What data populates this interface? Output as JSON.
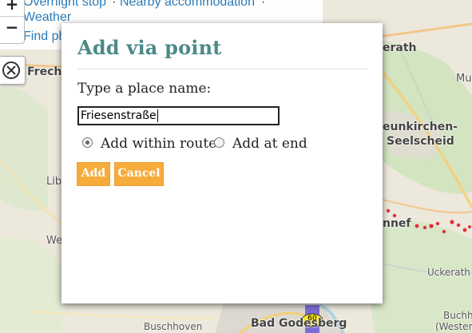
{
  "map": {
    "labels": [
      {
        "text": "Frech",
        "cls": "bold"
      },
      {
        "text": "erath",
        "cls": "bold"
      },
      {
        "text": "Mu",
        "cls": ""
      },
      {
        "text": "eunkirchen-",
        "cls": "bold"
      },
      {
        "text": "Seelscheid",
        "cls": "bold"
      },
      {
        "text": "Lib",
        "cls": ""
      },
      {
        "text": "nnef",
        "cls": "bold"
      },
      {
        "text": "We",
        "cls": ""
      },
      {
        "text": "Uckerath",
        "cls": "small"
      },
      {
        "text": "Buschhoven",
        "cls": "small"
      },
      {
        "text": "Bad Godesberg",
        "cls": "bold"
      },
      {
        "text": "Buchh",
        "cls": "small"
      },
      {
        "text": "(Wester",
        "cls": "small"
      }
    ],
    "route_badge": "60"
  },
  "info": {
    "link_overnight": "Overnight stop",
    "sep1": "·",
    "link_accommodation": "Nearby accommodation",
    "sep2": "·",
    "link_weather": "Weather",
    "link_find": "Find ph"
  },
  "zoom": {
    "in": "+",
    "out": "−"
  },
  "dialog": {
    "title": "Add via point",
    "prompt": "Type a place name:",
    "input_value": "Friesenstraße",
    "options": [
      {
        "label": "Add within route",
        "checked": true
      },
      {
        "label": "Add at end",
        "checked": false
      }
    ],
    "add_label": "Add",
    "cancel_label": "Cancel"
  },
  "colors": {
    "title": "#4b8a87",
    "button": "#f6ac3a",
    "link": "#2b7bb9",
    "route": "#e0303a"
  }
}
